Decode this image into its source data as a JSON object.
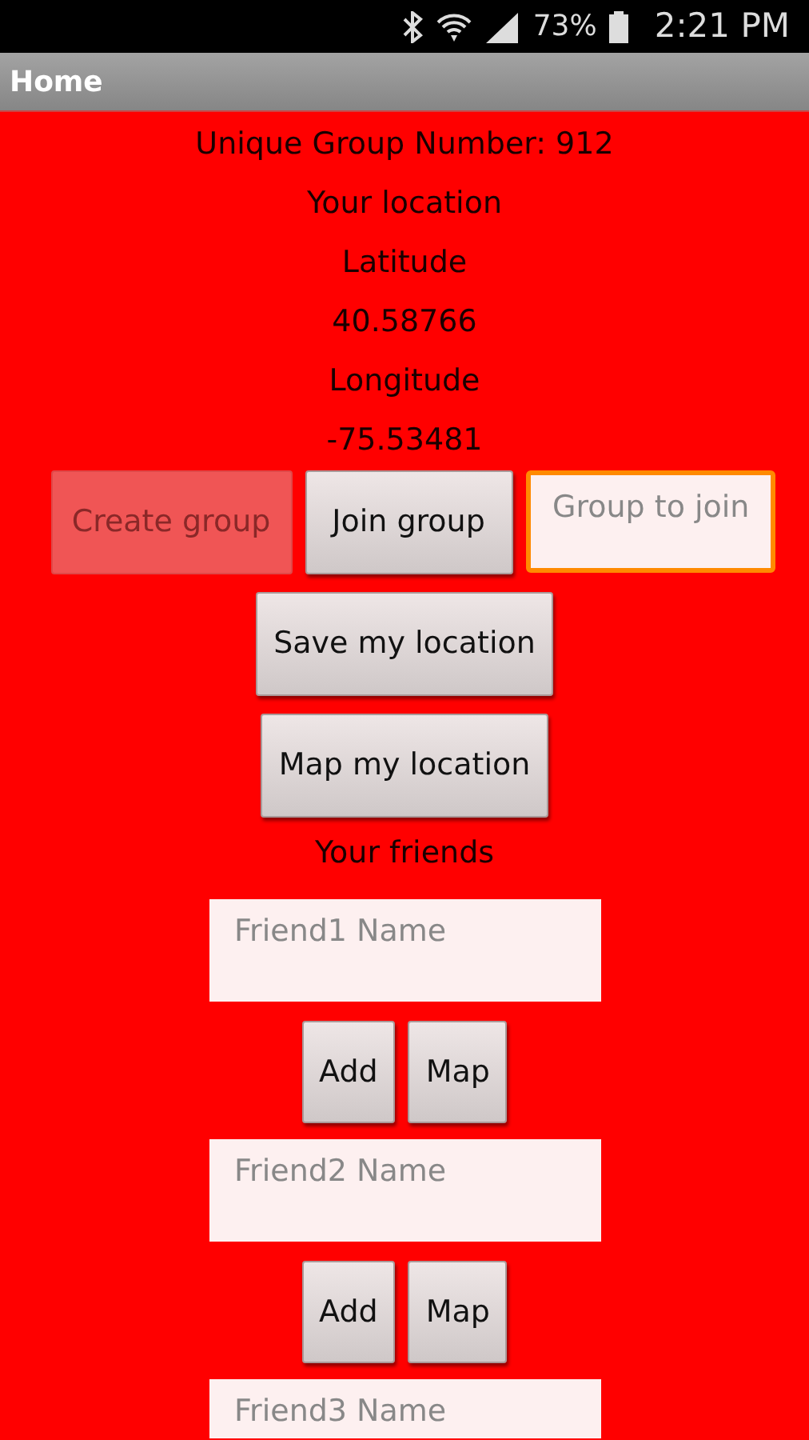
{
  "status_bar": {
    "battery": "73%",
    "time": "2:21 PM"
  },
  "app_bar": {
    "title": "Home"
  },
  "info_lines": [
    "Unique Group Number:  912",
    "Your location",
    "Latitude",
    "40.58766",
    "Longitude",
    "-75.53481"
  ],
  "group_row": {
    "create_button": {
      "label": "Create group",
      "disabled": true
    },
    "join_button": {
      "label": "Join group",
      "disabled": false
    },
    "group_field": {
      "placeholder": "Group to join",
      "focused": true
    }
  },
  "location_buttons": [
    {
      "label": "Save my location"
    },
    {
      "label": "Map my location"
    }
  ],
  "friends_heading": "Your friends",
  "friends": [
    {
      "placeholder": "Friend1 Name",
      "buttons": [
        "Add",
        "Map"
      ]
    },
    {
      "placeholder": "Friend2 Name",
      "buttons": [
        "Add",
        "Map"
      ]
    },
    {
      "placeholder": "Friend3 Name"
    }
  ]
}
